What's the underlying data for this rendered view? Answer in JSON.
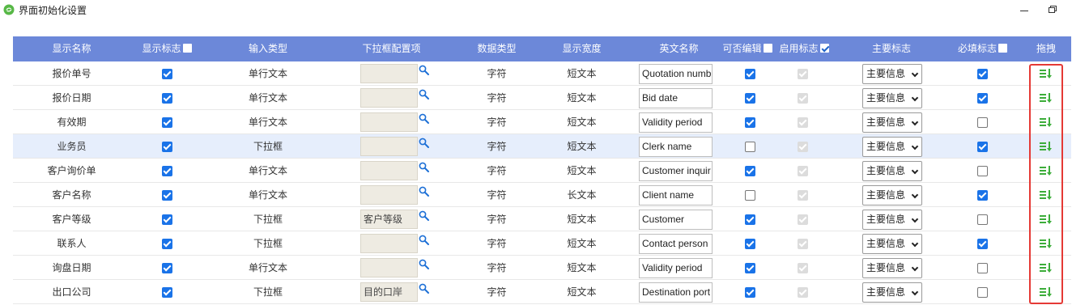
{
  "window": {
    "title": "界面初始化设置"
  },
  "header": {
    "columns": [
      "显示名称",
      "显示标志",
      "输入类型",
      "下拉框配置项",
      "数据类型",
      "显示宽度",
      "英文名称",
      "可否编辑",
      "启用标志",
      "主要标志",
      "必填标志",
      "拖拽"
    ],
    "show_flag_checked": false,
    "editable_checked": false,
    "enabled_checked": true,
    "required_checked": false
  },
  "rows": [
    {
      "name": "报价单号",
      "show": true,
      "input_type": "单行文本",
      "dropdown": "",
      "data_type": "字符",
      "width": "短文本",
      "english": "Quotation numb",
      "editable": true,
      "enabled": true,
      "main": "主要信息",
      "required": true
    },
    {
      "name": "报价日期",
      "show": true,
      "input_type": "单行文本",
      "dropdown": "",
      "data_type": "字符",
      "width": "短文本",
      "english": "Bid date",
      "editable": true,
      "enabled": true,
      "main": "主要信息",
      "required": true
    },
    {
      "name": "有效期",
      "show": true,
      "input_type": "单行文本",
      "dropdown": "",
      "data_type": "字符",
      "width": "短文本",
      "english": "Validity period",
      "editable": true,
      "enabled": true,
      "main": "主要信息",
      "required": false
    },
    {
      "name": "业务员",
      "show": true,
      "input_type": "下拉框",
      "dropdown": "",
      "data_type": "字符",
      "width": "短文本",
      "english": "Clerk name",
      "editable": false,
      "enabled": true,
      "main": "主要信息",
      "required": true
    },
    {
      "name": "客户询价单",
      "show": true,
      "input_type": "单行文本",
      "dropdown": "",
      "data_type": "字符",
      "width": "短文本",
      "english": "Customer inquir",
      "editable": true,
      "enabled": true,
      "main": "主要信息",
      "required": false
    },
    {
      "name": "客户名称",
      "show": true,
      "input_type": "单行文本",
      "dropdown": "",
      "data_type": "字符",
      "width": "长文本",
      "english": "Client name",
      "editable": false,
      "enabled": true,
      "main": "主要信息",
      "required": true
    },
    {
      "name": "客户等级",
      "show": true,
      "input_type": "下拉框",
      "dropdown": "客户等级",
      "data_type": "字符",
      "width": "短文本",
      "english": "Customer grade",
      "editable": true,
      "enabled": true,
      "main": "主要信息",
      "required": false
    },
    {
      "name": "联系人",
      "show": true,
      "input_type": "下拉框",
      "dropdown": "",
      "data_type": "字符",
      "width": "短文本",
      "english": "Contact person",
      "editable": true,
      "enabled": true,
      "main": "主要信息",
      "required": true
    },
    {
      "name": "询盘日期",
      "show": true,
      "input_type": "单行文本",
      "dropdown": "",
      "data_type": "字符",
      "width": "短文本",
      "english": "Validity period",
      "editable": true,
      "enabled": true,
      "main": "主要信息",
      "required": false
    },
    {
      "name": "出口公司",
      "show": true,
      "input_type": "下拉框",
      "dropdown": "目的口岸",
      "data_type": "字符",
      "width": "短文本",
      "english": "Destination port",
      "editable": true,
      "enabled": true,
      "main": "主要信息",
      "required": false
    }
  ],
  "selected_row": 3,
  "colors": {
    "header_bg": "#6c88d9",
    "checkbox_blue": "#1a73e8",
    "drag_green": "#3cad3a",
    "highlight_red": "#e53935"
  },
  "icons": {
    "logo": "app-logo-icon",
    "search": "magnifier-icon",
    "drag": "drag-handle-icon"
  }
}
